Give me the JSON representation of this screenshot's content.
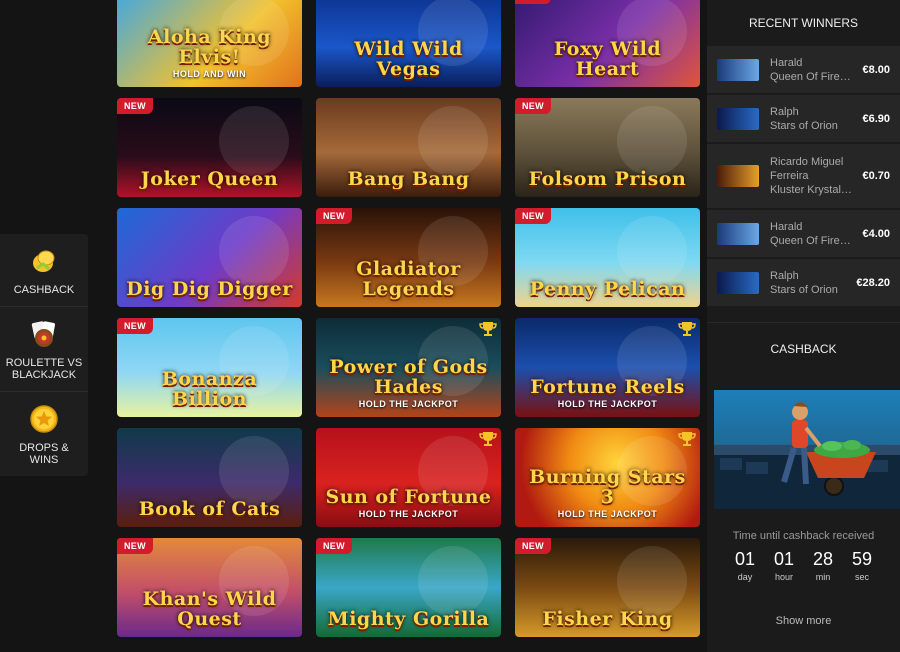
{
  "side_menu": {
    "items": [
      {
        "label": "CASHBACK",
        "icon": "cashback-coin-icon"
      },
      {
        "label": "ROULETTE VS BLACKJACK",
        "icon": "roulette-cards-icon"
      },
      {
        "label": "DROPS & WINS",
        "icon": "star-coin-icon"
      }
    ]
  },
  "badges": {
    "new": "NEW"
  },
  "games": [
    {
      "title": "Aloha King Elvis!",
      "sub": "HOLD AND WIN",
      "new": false,
      "trophy": false,
      "bg": "linear-gradient(135deg,#3da7e6,#f2c12e 60%,#e2721b)"
    },
    {
      "title": "Wild Wild Vegas",
      "sub": "",
      "new": false,
      "trophy": false,
      "bg": "linear-gradient(180deg,#0b2f8a,#1a57c9 60%,#0a1e5a)"
    },
    {
      "title": "Foxy Wild Heart",
      "sub": "",
      "new": true,
      "trophy": false,
      "bg": "linear-gradient(135deg,#2e1a6e,#7b2fa8 55%,#e0553a)"
    },
    {
      "title": "Joker Queen",
      "sub": "",
      "new": true,
      "trophy": false,
      "bg": "linear-gradient(180deg,#0a0a14,#2a0c1a 60%,#b3122a)"
    },
    {
      "title": "Bang Bang",
      "sub": "",
      "new": false,
      "trophy": false,
      "bg": "linear-gradient(180deg,#6a3b1f,#a56a3a 55%,#3b1c0c)"
    },
    {
      "title": "Folsom Prison",
      "sub": "",
      "new": true,
      "trophy": false,
      "bg": "linear-gradient(180deg,#8a7a5a,#5e513a 55%,#2a2418)"
    },
    {
      "title": "Dig Dig Digger",
      "sub": "",
      "new": false,
      "trophy": false,
      "bg": "linear-gradient(135deg,#1c6ad6,#6f3bc8 55%,#d6392a)"
    },
    {
      "title": "Gladiator Legends",
      "sub": "",
      "new": true,
      "trophy": false,
      "bg": "linear-gradient(180deg,#2a1208,#7a3a12 55%,#c7781e)"
    },
    {
      "title": "Penny Pelican",
      "sub": "",
      "new": true,
      "trophy": false,
      "bg": "linear-gradient(180deg,#3fc0ea,#7fd9f2 55%,#f1d38a)"
    },
    {
      "title": "Bonanza Billion",
      "sub": "",
      "new": true,
      "trophy": false,
      "bg": "linear-gradient(180deg,#5fc6ee,#8fd7f4 55%,#e8f3a0)"
    },
    {
      "title": "Power of Gods Hades",
      "sub": "HOLD THE JACKPOT",
      "new": false,
      "trophy": true,
      "bg": "linear-gradient(180deg,#0d2c38,#1b4d5c 50%,#b3441a)"
    },
    {
      "title": "Fortune Reels",
      "sub": "HOLD THE JACKPOT",
      "new": false,
      "trophy": true,
      "bg": "linear-gradient(180deg,#0a2a6a,#1b4fae 50%,#7a1010)"
    },
    {
      "title": "Book of Cats",
      "sub": "",
      "new": false,
      "trophy": false,
      "bg": "linear-gradient(180deg,#0f3a4a,#3c2b6a 55%,#5a1e0e)"
    },
    {
      "title": "Sun of Fortune",
      "sub": "HOLD THE JACKPOT",
      "new": false,
      "trophy": true,
      "bg": "linear-gradient(180deg,#b5111a,#d92220 55%,#8a0c12)"
    },
    {
      "title": "Burning Stars 3",
      "sub": "HOLD THE JACKPOT",
      "new": false,
      "trophy": true,
      "bg": "radial-gradient(circle at 55% 35%,#ffd43a,#f08a12 40%,#b01a10 80%)"
    },
    {
      "title": "Khan's Wild Quest",
      "sub": "",
      "new": true,
      "trophy": false,
      "bg": "linear-gradient(180deg,#e28a3a,#c24e6a 55%,#6a2a8a)"
    },
    {
      "title": "Mighty Gorilla",
      "sub": "",
      "new": true,
      "trophy": false,
      "bg": "linear-gradient(180deg,#1f7a4a,#3aa7c8 50%,#146a34)"
    },
    {
      "title": "Fisher King",
      "sub": "",
      "new": true,
      "trophy": false,
      "bg": "linear-gradient(180deg,#2a1a0a,#7a4a12 50%,#d69a2a)"
    }
  ],
  "recent_winners": {
    "title": "RECENT WINNERS",
    "rows": [
      {
        "name": "Harald",
        "game": "Queen Of Fire…",
        "amount": "€8.00",
        "thumb": "linear-gradient(90deg,#1b3a7a,#6aa8e8)"
      },
      {
        "name": "Ralph",
        "game": "Stars of Orion",
        "amount": "€6.90",
        "thumb": "linear-gradient(90deg,#0a1a4a,#2a6ac8)"
      },
      {
        "name": "Ricardo Miguel Ferreira",
        "game": "Kluster Krystal…",
        "amount": "€0.70",
        "thumb": "linear-gradient(90deg,#4a1a0a,#e8a02a)"
      },
      {
        "name": "Harald",
        "game": "Queen Of Fire…",
        "amount": "€4.00",
        "thumb": "linear-gradient(90deg,#1b3a7a,#6aa8e8)"
      },
      {
        "name": "Ralph",
        "game": "Stars of Orion",
        "amount": "€28.20",
        "thumb": "linear-gradient(90deg,#0a1a4a,#2a6ac8)"
      }
    ]
  },
  "cashback": {
    "title": "CASHBACK",
    "timer_label": "Time until cashback received",
    "timer": [
      {
        "value": "01",
        "unit": "day"
      },
      {
        "value": "01",
        "unit": "hour"
      },
      {
        "value": "28",
        "unit": "min"
      },
      {
        "value": "59",
        "unit": "sec"
      }
    ],
    "show_more": "Show more"
  },
  "colors": {
    "background": "#141414",
    "panel": "#1b1b1b",
    "badge_new": "#d31b2b",
    "gold": "#ffd54a"
  }
}
